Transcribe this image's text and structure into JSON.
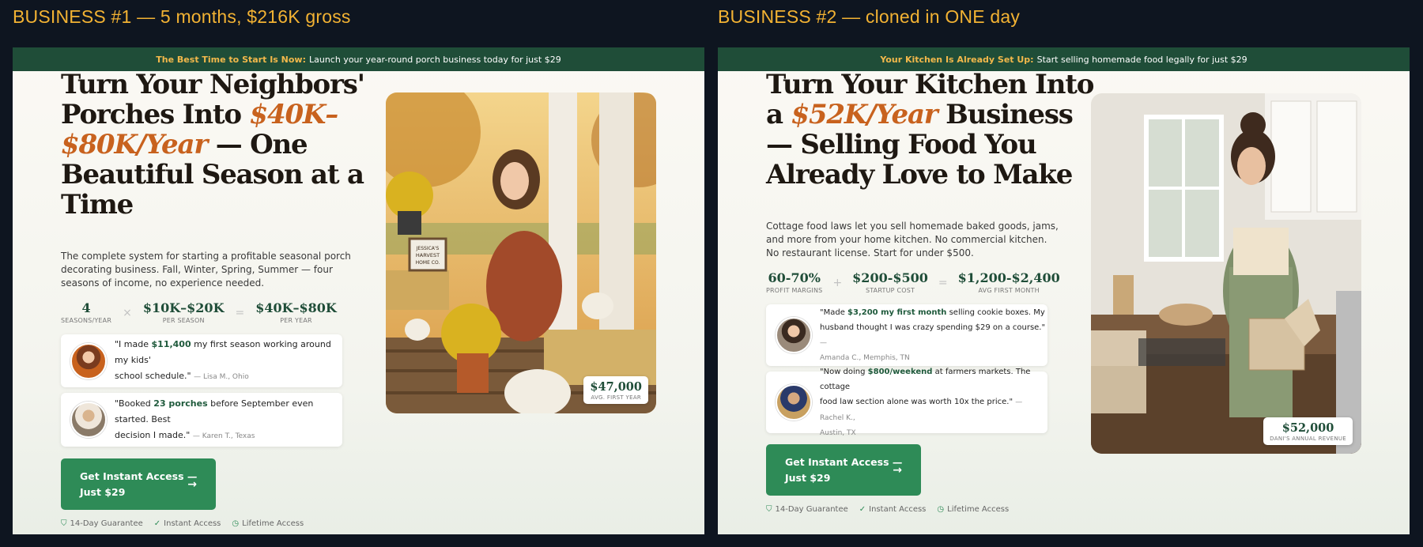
{
  "left": {
    "caption": "BUSINESS #1 — 5 months, $216K gross",
    "banner": {
      "highlight": "The Best Time to Start Is Now:",
      "text": "Launch your year-round porch business today for just $29"
    },
    "headline": {
      "line1": "Turn Your Neighbors'",
      "line2_pre": "Porches Into",
      "line2_accent": "$40K–",
      "line3_accent": "$80K/Year",
      "line3_post": "— One",
      "line4": "Beautiful Season at a",
      "line5": "Time"
    },
    "subtext": [
      "The complete system for starting a profitable seasonal porch",
      "decorating business. Fall, Winter, Spring, Summer — four",
      "seasons of income, no experience needed."
    ],
    "stats": [
      {
        "value": "4",
        "label": "SEASONS/YEAR"
      },
      {
        "op": "×"
      },
      {
        "value": "$10K–$20K",
        "label": "PER SEASON"
      },
      {
        "op": "="
      },
      {
        "value": "$40K–$80K",
        "label": "PER YEAR"
      }
    ],
    "testimonials": [
      {
        "pre": "\"I made ",
        "bold": "$11,400",
        "post": " my first season working around my kids'",
        "line2": "school schedule.\"",
        "who": "— Lisa M., Ohio"
      },
      {
        "pre": "\"Booked ",
        "bold": "23 porches",
        "post": " before September even started. Best",
        "line2": "decision I made.\"",
        "who": "— Karen T., Texas"
      }
    ],
    "cta": {
      "line1": "Get Instant Access —",
      "line2": "Just $29",
      "arrow": "→"
    },
    "guarantees": [
      {
        "icon": "shield-icon",
        "label": "14-Day Guarantee"
      },
      {
        "icon": "check-circle-icon",
        "label": "Instant Access"
      },
      {
        "icon": "clock-icon",
        "label": "Lifetime Access"
      }
    ],
    "badge": {
      "value": "$47,000",
      "label": "AVG. FIRST YEAR"
    },
    "photo_sign": [
      "JESSICA'S",
      "HARVEST",
      "HOME CO."
    ]
  },
  "right": {
    "caption": "BUSINESS #2 — cloned in ONE day",
    "banner": {
      "highlight": "Your Kitchen Is Already Set Up:",
      "text": "Start selling homemade food legally for just $29"
    },
    "headline": {
      "line1": "Turn Your Kitchen Into",
      "line2_pre": "a",
      "line2_accent": "$52K/Year",
      "line2_post": "Business",
      "line3": "— Selling Food You",
      "line4": "Already Love to Make"
    },
    "subtext": [
      "Cottage food laws let you sell homemade baked goods, jams,",
      "and more from your home kitchen. No commercial kitchen.",
      "No restaurant license. Start for under $500."
    ],
    "stats": [
      {
        "value": "60-70%",
        "label": "PROFIT MARGINS"
      },
      {
        "op": "+"
      },
      {
        "value": "$200-$500",
        "label": "STARTUP COST"
      },
      {
        "op": "="
      },
      {
        "value": "$1,200-$2,400",
        "label": "AVG FIRST MONTH"
      }
    ],
    "testimonials": [
      {
        "pre": "\"Made ",
        "bold": "$3,200 my first month",
        "post": " selling cookie boxes. My",
        "line2": "husband thought I was crazy spending $29 on a course.\"",
        "who": "—",
        "line3": "Amanda C., Memphis, TN"
      },
      {
        "pre": "\"Now doing ",
        "bold": "$800/weekend",
        "post": " at farmers markets. The cottage",
        "line2": "food law section alone was worth 10x the price.\"",
        "who": "— Rachel K.,",
        "line3": "Austin, TX"
      }
    ],
    "cta": {
      "line1": "Get Instant Access —",
      "line2": "Just $29",
      "arrow": "→"
    },
    "guarantees": [
      {
        "icon": "shield-icon",
        "label": "14-Day Guarantee"
      },
      {
        "icon": "check-circle-icon",
        "label": "Instant Access"
      },
      {
        "icon": "clock-icon",
        "label": "Lifetime Access"
      }
    ],
    "badge": {
      "value": "$52,000",
      "label": "DANI'S ANNUAL REVENUE"
    }
  },
  "colors": {
    "page_bg": "#0e1520",
    "caption": "#f2b233",
    "banner_bg": "#1f4d38",
    "banner_highlight": "#f2b84b",
    "accent_orange": "#c8621e",
    "brand_green": "#1f4d38",
    "cta_green": "#2e8b57"
  }
}
